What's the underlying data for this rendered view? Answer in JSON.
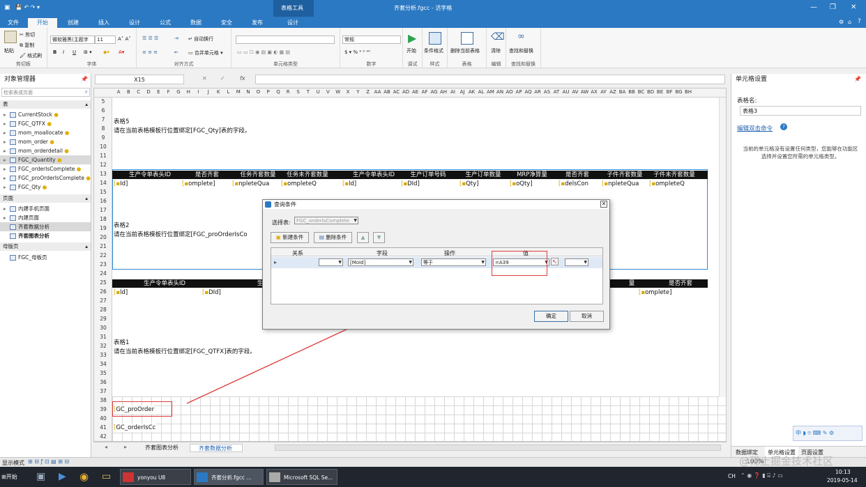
{
  "titlebar": {
    "tool_context": "表格工具",
    "file_title": "齐套分析.fgcc - 活字格",
    "controls": [
      "—",
      "❐",
      "✕"
    ]
  },
  "ribbon_tabs": [
    "文件",
    "开始",
    "创建",
    "插入",
    "设计",
    "公式",
    "数据",
    "安全",
    "发布",
    "设计"
  ],
  "ribbon": {
    "clipboard": {
      "paste": "粘贴",
      "cut": "剪切",
      "copy": "复制",
      "format_painter": "格式刷",
      "label": "剪切板"
    },
    "font": {
      "family": "微软雅黑(主题字",
      "size": "11",
      "bold": "B",
      "italic": "I",
      "underline": "U",
      "label": "字体"
    },
    "alignment": {
      "wrap": "自动换行",
      "merge": "合并单元格",
      "label": "对齐方式"
    },
    "celltype": {
      "label": "单元格类型"
    },
    "number": {
      "format": "常规",
      "label": "数字"
    },
    "debug": {
      "start": "开始",
      "label": "调试"
    },
    "style": {
      "conditional": "条件格式",
      "label": "样式"
    },
    "table": {
      "delete_table": "删除当前表格",
      "label": "表格"
    },
    "edit": {
      "clear": "清除",
      "label": "编辑"
    },
    "find": {
      "find_replace": "查找和替换",
      "label": "查找和替换"
    },
    "help": "?"
  },
  "left_panel": {
    "title": "对象管理器",
    "search_placeholder": "检索表或页面",
    "sections": {
      "tables": "表",
      "pages": "页面",
      "master": "母版页"
    },
    "tables": [
      "CurrentStock",
      "FGC_QTFX",
      "mom_moallocate",
      "mom_order",
      "mom_orderdetail",
      "FGC_iQuantity",
      "FGC_orderIsComplete",
      "FGC_proOrderIsComplete",
      "FGC_Qty"
    ],
    "pages": [
      "内建手机页面",
      "内建页面",
      "齐套数据分析",
      "齐套图表分析"
    ],
    "masters": [
      "FGC_母板页"
    ]
  },
  "formula": {
    "cell_ref": "X15",
    "fx": "fx"
  },
  "sheet": {
    "columns": [
      "A",
      "B",
      "C",
      "D",
      "E",
      "F",
      "G",
      "H",
      "I",
      "J",
      "K",
      "L",
      "M",
      "N",
      "O",
      "P",
      "Q",
      "R",
      "S",
      "T",
      "U",
      "V",
      "W",
      "X",
      "Y",
      "Z",
      "AA",
      "AB",
      "AC",
      "AD",
      "AE",
      "AF",
      "AG",
      "AH",
      "AI",
      "AJ",
      "AK",
      "AL",
      "AM",
      "AN",
      "AO",
      "AP",
      "AQ",
      "AR",
      "AS",
      "AT",
      "AU",
      "AV",
      "AW",
      "AX",
      "AY",
      "AZ",
      "BA",
      "BB",
      "BC",
      "BD",
      "BE",
      "BF",
      "BG",
      "BH"
    ],
    "rows": [
      "5",
      "6",
      "7",
      "8",
      "9",
      "10",
      "11",
      "12",
      "13",
      "14",
      "15",
      "16",
      "17",
      "18",
      "19",
      "20",
      "21",
      "22",
      "23",
      "24",
      "25",
      "26",
      "27",
      "28",
      "29",
      "30",
      "31",
      "32",
      "33",
      "34",
      "35",
      "36",
      "37",
      "38",
      "39",
      "40",
      "41",
      "42"
    ],
    "table5_title": "表格5",
    "table5_desc": "请在当前表格模板行位置绑定[FGC_Qty]表的字段。",
    "table2_title": "表格2",
    "table2_desc": "请在当前表格模板行位置绑定[FGC_proOrderIsCo",
    "table1_title": "表格1",
    "table1_desc": "请在当前表格模板行位置绑定[FGC_QTFX]表的字段。",
    "headers_row13": [
      "生产令单表头ID",
      "是否齐套",
      "任务齐套数量",
      "任务未齐套数量",
      "生产令单表头ID",
      "生产订单号码",
      "生产订单数量",
      "MRP净算量",
      "是否齐套",
      "子件齐套数量",
      "子件未齐套数量"
    ],
    "fields_row14": [
      "Id]",
      "omplete]",
      "npleteQua",
      "ompleteQ",
      "ld]",
      "DId]",
      "Qty]",
      "oQty]",
      "delsCon",
      "npleteQua",
      "ompleteQ"
    ],
    "headers_row25": [
      "生产令单表头ID",
      "生产订单号",
      "量",
      "是否齐套"
    ],
    "fields_row26": [
      "ld]",
      "DId]",
      "omplete]"
    ],
    "cell_a39": "GC_proOrder",
    "cell_a41": "GC_orderIsCc"
  },
  "dialog": {
    "title": "查询条件",
    "select_table_label": "选择表:",
    "select_table_value": "FGC_orderIsComplete",
    "new_condition": "新建条件",
    "delete_condition": "删除条件",
    "col_relation": "关系",
    "col_field": "字段",
    "col_operation": "操作",
    "col_value": "值",
    "row_field": "[MoId]",
    "row_operation": "等于",
    "row_value": "=A39",
    "ok": "确定",
    "cancel": "取消"
  },
  "right_panel": {
    "title": "单元格设置",
    "table_name_label": "表格名:",
    "table_name_value": "表格3",
    "edit_dblclick": "编辑双击命令",
    "info": "当前的单元格没有设置任何类型，您能够在功能区选择并设置您所需的单元格类型。",
    "tabs": [
      "数据绑定",
      "单元格设置",
      "页面设置"
    ]
  },
  "sheet_tabs": [
    "齐套图表分析",
    "齐套数据分析"
  ],
  "status": {
    "mode": "显示模式",
    "zoom": "100%",
    "watermark": "@稀土掘金技术社区"
  },
  "taskbar": {
    "start": "开始",
    "items": [
      "yonyou U8",
      "齐套分析.fgcc ...",
      "Microsoft SQL Se..."
    ],
    "lang": "CH",
    "time": "10:13",
    "date": "2019-05-14"
  },
  "colors": {
    "accent": "#2b79c2",
    "header_black": "#111111",
    "arrow_red": "#e03b3b"
  }
}
